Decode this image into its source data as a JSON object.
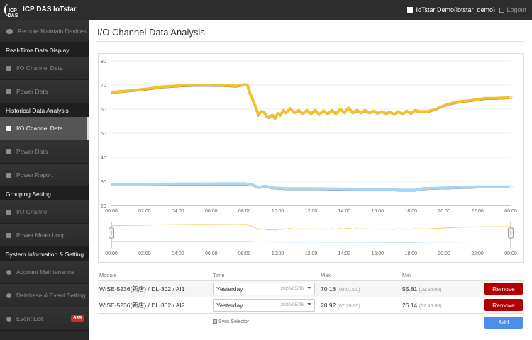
{
  "header": {
    "brand": "ICP DAS IoTstar",
    "logo_text": "ICP DAS",
    "user": "IoTstar Demo(iotstar_demo)",
    "logout": "Logout"
  },
  "sidebar": [
    {
      "type": "item",
      "label": "Remote Maintain Devices",
      "icon": "cloud-icon"
    },
    {
      "type": "header",
      "label": "Real-Time Data Display"
    },
    {
      "type": "item",
      "label": "I/O Channel Data",
      "icon": "chart-icon"
    },
    {
      "type": "item",
      "label": "Power Data",
      "icon": "chart-icon"
    },
    {
      "type": "header",
      "label": "Historical Data Analysis"
    },
    {
      "type": "item",
      "label": "I/O Channel Data",
      "icon": "chart-icon",
      "selected": true
    },
    {
      "type": "item",
      "label": "Power Data",
      "icon": "chart-icon"
    },
    {
      "type": "item",
      "label": "Power Report",
      "icon": "report-icon"
    },
    {
      "type": "header",
      "label": "Grouping Setting"
    },
    {
      "type": "item",
      "label": "I/O Channel",
      "icon": "list-icon"
    },
    {
      "type": "item",
      "label": "Power Meter Loop",
      "icon": "list-icon"
    },
    {
      "type": "header",
      "label": "System Information & Setting"
    },
    {
      "type": "item",
      "label": "Account Maintenance",
      "icon": "gear-icon"
    },
    {
      "type": "item",
      "label": "Database & Event Setting",
      "icon": "gear-icon"
    },
    {
      "type": "item",
      "label": "Event List",
      "icon": "bell-icon",
      "badge": "635"
    }
  ],
  "page": {
    "title": "I/O Channel Data Analysis"
  },
  "chart_data": {
    "type": "line",
    "ylim": [
      20,
      80
    ],
    "yticks": [
      "80",
      "70",
      "60",
      "50",
      "40",
      "30",
      "20"
    ],
    "xticks": [
      "00:00",
      "02:00",
      "04:00",
      "06:00",
      "08:00",
      "10:00",
      "12:00",
      "14:00",
      "16:00",
      "18:00",
      "20:00",
      "22:00",
      "00:00"
    ],
    "grid": true,
    "navigator": true,
    "series": [
      {
        "color": "#f0c030",
        "points": [
          [
            "00:00",
            67
          ],
          [
            "01:00",
            67.6
          ],
          [
            "02:00",
            68.3
          ],
          [
            "03:00",
            69.2
          ],
          [
            "04:00",
            69.7
          ],
          [
            "05:00",
            70
          ],
          [
            "06:00",
            70
          ],
          [
            "07:00",
            69.8
          ],
          [
            "07:30",
            69.6
          ],
          [
            "08:00",
            70.2
          ],
          [
            "08:10",
            70.1
          ],
          [
            "08:20",
            66.5
          ],
          [
            "08:40",
            61
          ],
          [
            "08:50",
            57.5
          ],
          [
            "09:00",
            59
          ],
          [
            "09:10",
            58.8
          ],
          [
            "09:20",
            57
          ],
          [
            "09:30",
            56.5
          ],
          [
            "09:40",
            57.5
          ],
          [
            "09:50",
            56
          ],
          [
            "10:00",
            58.2
          ],
          [
            "10:10",
            57.5
          ],
          [
            "10:20",
            59.5
          ],
          [
            "10:30",
            58.5
          ],
          [
            "10:45",
            60.2
          ],
          [
            "11:00",
            58.5
          ],
          [
            "11:15",
            59.5
          ],
          [
            "11:30",
            58
          ],
          [
            "11:45",
            59.5
          ],
          [
            "12:00",
            58
          ],
          [
            "12:15",
            59.5
          ],
          [
            "12:30",
            57.8
          ],
          [
            "12:45",
            59.3
          ],
          [
            "13:00",
            58
          ],
          [
            "13:15",
            59.5
          ],
          [
            "13:30",
            58
          ],
          [
            "13:45",
            60
          ],
          [
            "14:00",
            58.5
          ],
          [
            "14:15",
            60.5
          ],
          [
            "14:30",
            58.5
          ],
          [
            "14:45",
            59.5
          ],
          [
            "15:00",
            58.5
          ],
          [
            "15:15",
            59.5
          ],
          [
            "15:30",
            58.5
          ],
          [
            "15:45",
            59.2
          ],
          [
            "16:00",
            58.3
          ],
          [
            "16:15",
            59
          ],
          [
            "16:30",
            58.2
          ],
          [
            "16:45",
            58.8
          ],
          [
            "17:00",
            57.8
          ],
          [
            "17:15",
            59
          ],
          [
            "17:30",
            58
          ],
          [
            "17:45",
            59.2
          ],
          [
            "18:00",
            58.2
          ],
          [
            "18:15",
            59.5
          ],
          [
            "18:30",
            59
          ],
          [
            "19:00",
            59
          ],
          [
            "19:30",
            60
          ],
          [
            "20:00",
            61.5
          ],
          [
            "20:30",
            62.5
          ],
          [
            "21:00",
            63.2
          ],
          [
            "21:30",
            63.5
          ],
          [
            "22:00",
            64
          ],
          [
            "22:30",
            64.5
          ],
          [
            "23:00",
            64.5
          ],
          [
            "24:00",
            64.8
          ]
        ]
      },
      {
        "color": "#a8d4f5",
        "points": [
          [
            "00:00",
            28.7
          ],
          [
            "04:00",
            28.9
          ],
          [
            "08:00",
            29
          ],
          [
            "08:30",
            28.5
          ],
          [
            "08:50",
            27.6
          ],
          [
            "09:15",
            28
          ],
          [
            "09:45",
            27.3
          ],
          [
            "10:30",
            27
          ],
          [
            "12:00",
            27
          ],
          [
            "14:00",
            26.8
          ],
          [
            "16:00",
            26.7
          ],
          [
            "17:30",
            26.4
          ],
          [
            "18:15",
            26.4
          ],
          [
            "18:45",
            27
          ],
          [
            "20:00",
            27.3
          ],
          [
            "22:00",
            27.7
          ],
          [
            "24:00",
            27.7
          ]
        ]
      }
    ]
  },
  "table": {
    "headers": [
      "Module",
      "Time",
      "Max",
      "Min"
    ],
    "rows": [
      {
        "module": "WISE-5236(新店) / DL-302 / AI1",
        "time": "Yesterday",
        "date": "2020/05/06",
        "max": "70.18",
        "max_time": "(08:01:00)",
        "min": "55.81",
        "min_time": "(09:35:00)",
        "action": "Remove"
      },
      {
        "module": "WISE-5236(新店) / DL-302 / AI2",
        "time": "Yesterday",
        "date": "2020/05/06",
        "max": "28.92",
        "max_time": "(07:29:00)",
        "min": "26.14",
        "min_time": "(17:46:00)",
        "action": "Remove"
      }
    ],
    "sync_label": "Sync Selector",
    "sync_checked": true,
    "add_label": "Add"
  }
}
